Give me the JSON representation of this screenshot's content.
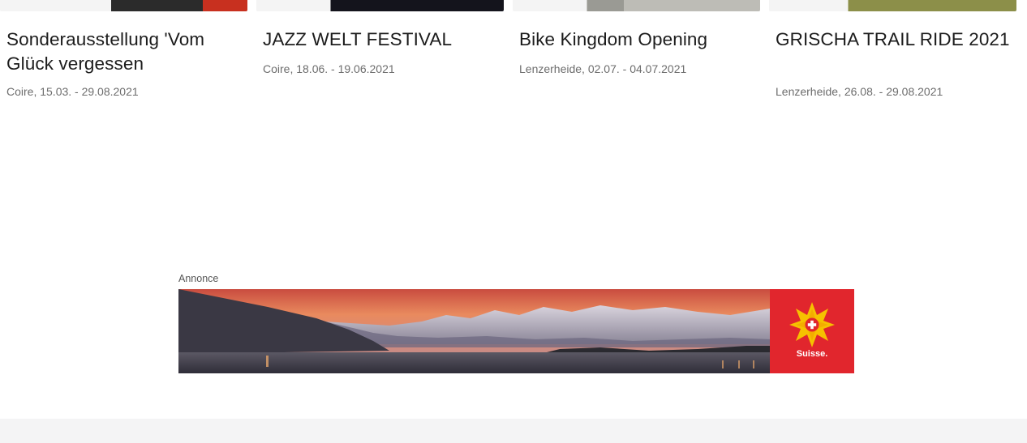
{
  "events": [
    {
      "title": "Sonderausstellung 'Vom Glück vergessen",
      "meta": "Coire, 15.03. - 29.08.2021"
    },
    {
      "title": "JAZZ WELT FESTIVAL",
      "meta": "Coire, 18.06. - 19.06.2021"
    },
    {
      "title": "Bike Kingdom Opening",
      "meta": "Lenzerheide, 02.07. - 04.07.2021"
    },
    {
      "title": "GRISCHA TRAIL RIDE 2021",
      "meta": "Lenzerheide, 26.08. - 29.08.2021"
    }
  ],
  "ad": {
    "label": "Annonce",
    "logo_text": "Suisse.",
    "logo_icon": "swiss-star-logo-icon",
    "brand_color": "#e1262d"
  }
}
